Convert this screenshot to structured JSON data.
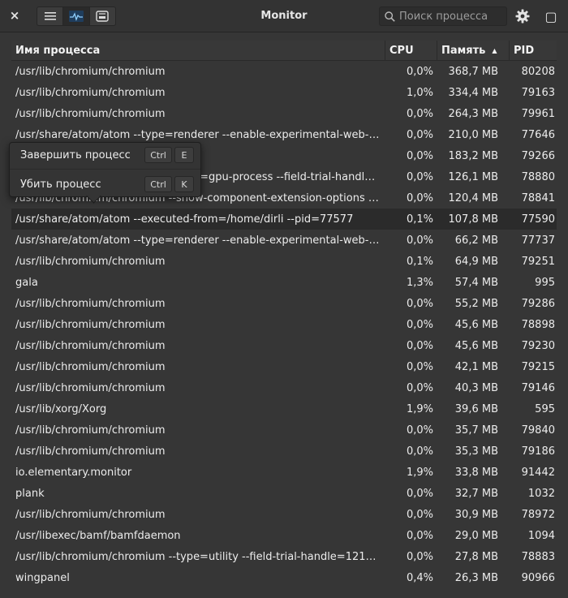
{
  "window": {
    "title": "Monitor",
    "close_glyph": "×",
    "restore_glyph": "▢"
  },
  "toolbar": {
    "view_buttons": [
      {
        "icon": "list-icon",
        "active": false
      },
      {
        "icon": "graph-icon",
        "active": true
      },
      {
        "icon": "system-info-icon",
        "active": false
      }
    ]
  },
  "search": {
    "placeholder": "Поиск процесса",
    "value": ""
  },
  "table": {
    "headers": {
      "name": "Имя процесса",
      "cpu": "CPU",
      "memory": "Память",
      "pid": "PID"
    },
    "sort_column": "memory",
    "sort_direction_glyph": "▲",
    "rows": [
      {
        "name": "/usr/lib/chromium/chromium",
        "cpu": "0,0%",
        "memory": "368,7 MB",
        "pid": "80208"
      },
      {
        "name": "/usr/lib/chromium/chromium",
        "cpu": "1,0%",
        "memory": "334,4 MB",
        "pid": "79163"
      },
      {
        "name": "/usr/lib/chromium/chromium",
        "cpu": "0,0%",
        "memory": "264,3 MB",
        "pid": "79961"
      },
      {
        "name": "/usr/share/atom/atom --type=renderer --enable-experimental-web-…",
        "cpu": "0,0%",
        "memory": "210,0 MB",
        "pid": "77646"
      },
      {
        "name": "",
        "cpu": "0,0%",
        "memory": "183,2 MB",
        "pid": "79266"
      },
      {
        "name": "/usr/lib/chromium/chromium --type=gpu-process --field-trial-handl…",
        "cpu": "0,0%",
        "memory": "126,1 MB",
        "pid": "78880"
      },
      {
        "name": "/usr/lib/chromium/chromium --show-component-extension-options …",
        "cpu": "0,0%",
        "memory": "120,4 MB",
        "pid": "78841"
      },
      {
        "name": "/usr/share/atom/atom --executed-from=/home/dirli --pid=77577",
        "cpu": "0,1%",
        "memory": "107,8 MB",
        "pid": "77590",
        "selected": true
      },
      {
        "name": "/usr/share/atom/atom --type=renderer --enable-experimental-web-…",
        "cpu": "0,0%",
        "memory": "66,2 MB",
        "pid": "77737"
      },
      {
        "name": "/usr/lib/chromium/chromium",
        "cpu": "0,1%",
        "memory": "64,9 MB",
        "pid": "79251"
      },
      {
        "name": "gala",
        "cpu": "1,3%",
        "memory": "57,4 MB",
        "pid": "995"
      },
      {
        "name": "/usr/lib/chromium/chromium",
        "cpu": "0,0%",
        "memory": "55,2 MB",
        "pid": "79286"
      },
      {
        "name": "/usr/lib/chromium/chromium",
        "cpu": "0,0%",
        "memory": "45,6 MB",
        "pid": "78898"
      },
      {
        "name": "/usr/lib/chromium/chromium",
        "cpu": "0,0%",
        "memory": "45,6 MB",
        "pid": "79230"
      },
      {
        "name": "/usr/lib/chromium/chromium",
        "cpu": "0,0%",
        "memory": "42,1 MB",
        "pid": "79215"
      },
      {
        "name": "/usr/lib/chromium/chromium",
        "cpu": "0,0%",
        "memory": "40,3 MB",
        "pid": "79146"
      },
      {
        "name": "/usr/lib/xorg/Xorg",
        "cpu": "1,9%",
        "memory": "39,6 MB",
        "pid": "595"
      },
      {
        "name": "/usr/lib/chromium/chromium",
        "cpu": "0,0%",
        "memory": "35,7 MB",
        "pid": "79840"
      },
      {
        "name": "/usr/lib/chromium/chromium",
        "cpu": "0,0%",
        "memory": "35,3 MB",
        "pid": "79186"
      },
      {
        "name": "io.elementary.monitor",
        "cpu": "1,9%",
        "memory": "33,8 MB",
        "pid": "91442"
      },
      {
        "name": "plank",
        "cpu": "0,0%",
        "memory": "32,7 MB",
        "pid": "1032"
      },
      {
        "name": "/usr/lib/chromium/chromium",
        "cpu": "0,0%",
        "memory": "30,9 MB",
        "pid": "78972"
      },
      {
        "name": "/usr/libexec/bamf/bamfdaemon",
        "cpu": "0,0%",
        "memory": "29,0 MB",
        "pid": "1094"
      },
      {
        "name": "/usr/lib/chromium/chromium --type=utility --field-trial-handle=121…",
        "cpu": "0,0%",
        "memory": "27,8 MB",
        "pid": "78883"
      },
      {
        "name": "wingpanel",
        "cpu": "0,4%",
        "memory": "26,3 MB",
        "pid": "90966"
      }
    ]
  },
  "context_menu": {
    "items": [
      {
        "label": "Завершить процесс",
        "modifier": "Ctrl",
        "key": "E"
      },
      {
        "label": "Убить процесс",
        "modifier": "Ctrl",
        "key": "K"
      }
    ]
  }
}
